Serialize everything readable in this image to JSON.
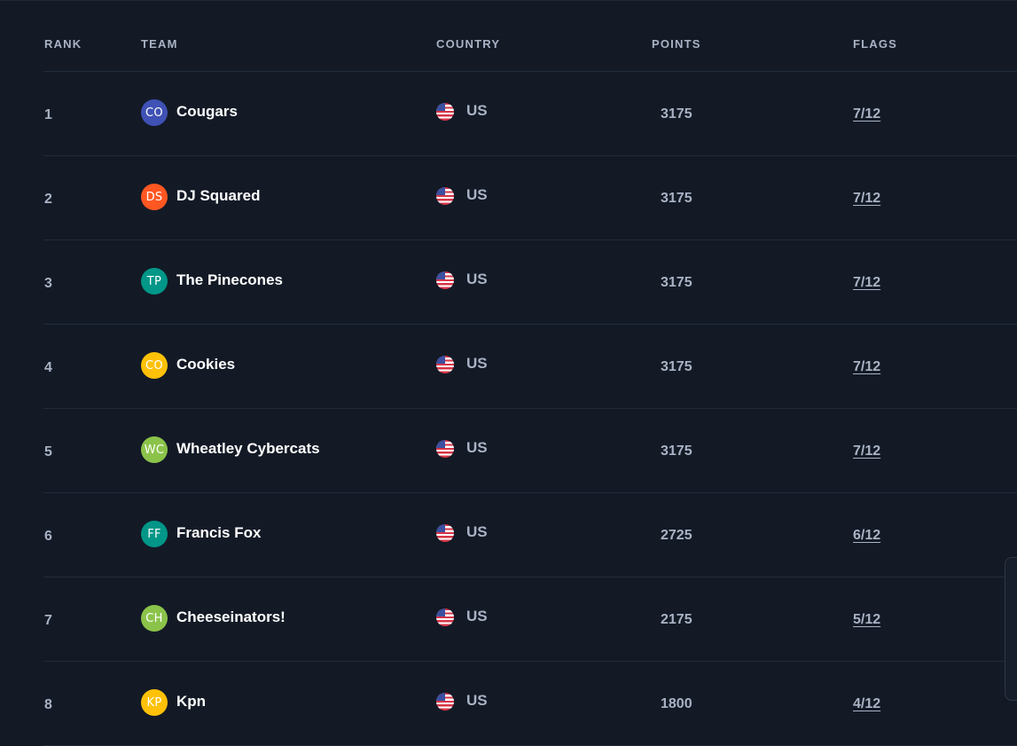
{
  "columns": {
    "rank": "RANK",
    "team": "TEAM",
    "country": "COUNTRY",
    "points": "POINTS",
    "flags": "FLAGS"
  },
  "rows": [
    {
      "rank": "1",
      "initials": "CO",
      "avatar_color": "#3f51b5",
      "team": "Cougars",
      "country": "US",
      "points": "3175",
      "flags": "7/12"
    },
    {
      "rank": "2",
      "initials": "DS",
      "avatar_color": "#ff5722",
      "team": "DJ Squared",
      "country": "US",
      "points": "3175",
      "flags": "7/12"
    },
    {
      "rank": "3",
      "initials": "TP",
      "avatar_color": "#009688",
      "team": "The Pinecones",
      "country": "US",
      "points": "3175",
      "flags": "7/12"
    },
    {
      "rank": "4",
      "initials": "CO",
      "avatar_color": "#ffc107",
      "team": "Cookies",
      "country": "US",
      "points": "3175",
      "flags": "7/12"
    },
    {
      "rank": "5",
      "initials": "WC",
      "avatar_color": "#8bc34a",
      "team": "Wheatley Cybercats",
      "country": "US",
      "points": "3175",
      "flags": "7/12"
    },
    {
      "rank": "6",
      "initials": "FF",
      "avatar_color": "#009688",
      "team": "Francis Fox",
      "country": "US",
      "points": "2725",
      "flags": "6/12"
    },
    {
      "rank": "7",
      "initials": "CH",
      "avatar_color": "#8bc34a",
      "team": "Cheeseinators!",
      "country": "US",
      "points": "2175",
      "flags": "5/12"
    },
    {
      "rank": "8",
      "initials": "KP",
      "avatar_color": "#ffc107",
      "team": "Kpn",
      "country": "US",
      "points": "1800",
      "flags": "4/12"
    }
  ],
  "flag_icon": "us-flag-icon"
}
